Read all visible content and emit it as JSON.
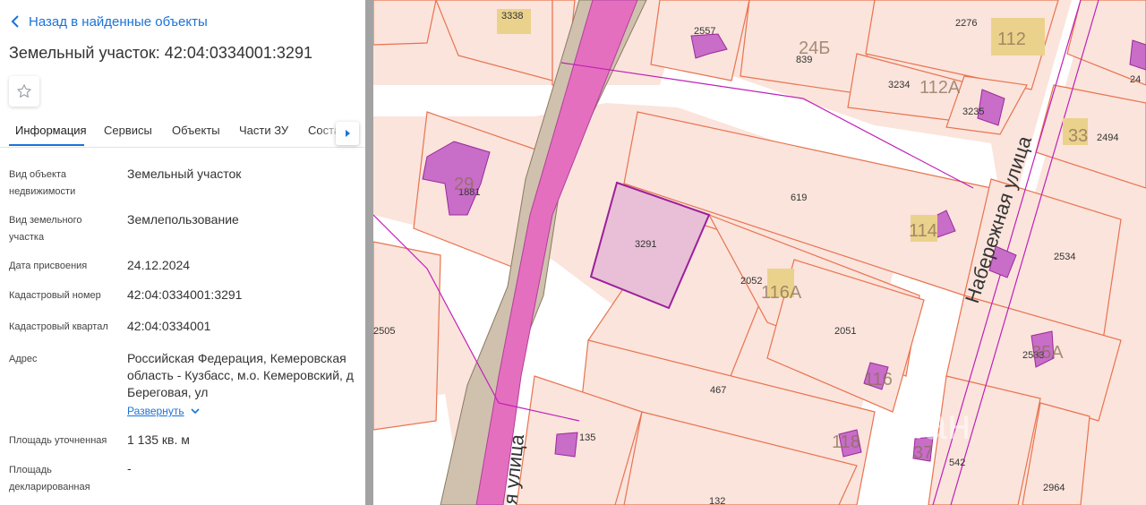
{
  "nav": {
    "back_label": "Назад в найденные объекты"
  },
  "title": "Земельный участок: 42:04:0334001:3291",
  "tabs": [
    {
      "label": "Информация",
      "active": true
    },
    {
      "label": "Сервисы"
    },
    {
      "label": "Объекты"
    },
    {
      "label": "Части ЗУ"
    },
    {
      "label": "Соста"
    }
  ],
  "details": {
    "object_type": {
      "label": "Вид объекта недвижимости",
      "value": "Земельный участок"
    },
    "land_type": {
      "label": "Вид земельного участка",
      "value": "Землепользование"
    },
    "date": {
      "label": "Дата присвоения",
      "value": "24.12.2024"
    },
    "cad_number": {
      "label": "Кадастровый номер",
      "value": "42:04:0334001:3291"
    },
    "cad_quarter": {
      "label": "Кадастровый квартал",
      "value": "42:04:0334001"
    },
    "address": {
      "label": "Адрес",
      "value": "Российская Федерация, Кемеровская область - Кузбасс, м.о. Кемеровский, д Береговая, ул",
      "expand_label": "Развернуть"
    },
    "area_specified": {
      "label": "Площадь уточненная",
      "value": "1 135 кв. м"
    },
    "area_declared": {
      "label": "Площадь декларированная",
      "value": "-"
    }
  },
  "map": {
    "street_main": "Набережная улица",
    "street_left": "я улица",
    "watermark": "циан",
    "colors": {
      "parcel_fill": "#fbe4dc",
      "parcel_line": "#e8734f",
      "building_fill": "#c86dc8",
      "road": "#e56fbf",
      "selected_fill": "#e8bfd6",
      "selected_line": "#9b1f9b"
    },
    "parcel_labels": [
      "3338",
      "2557",
      "839",
      "2276",
      "3234",
      "3235",
      "2494",
      "1881",
      "619",
      "3291",
      "2052",
      "2534",
      "2505",
      "2051",
      "2533",
      "467",
      "135",
      "542",
      "2964",
      "132",
      "24"
    ],
    "house_numbers": [
      "24Б",
      "112",
      "112А",
      "33",
      "29",
      "114",
      "116А",
      "116",
      "118",
      "35А",
      "37"
    ]
  }
}
